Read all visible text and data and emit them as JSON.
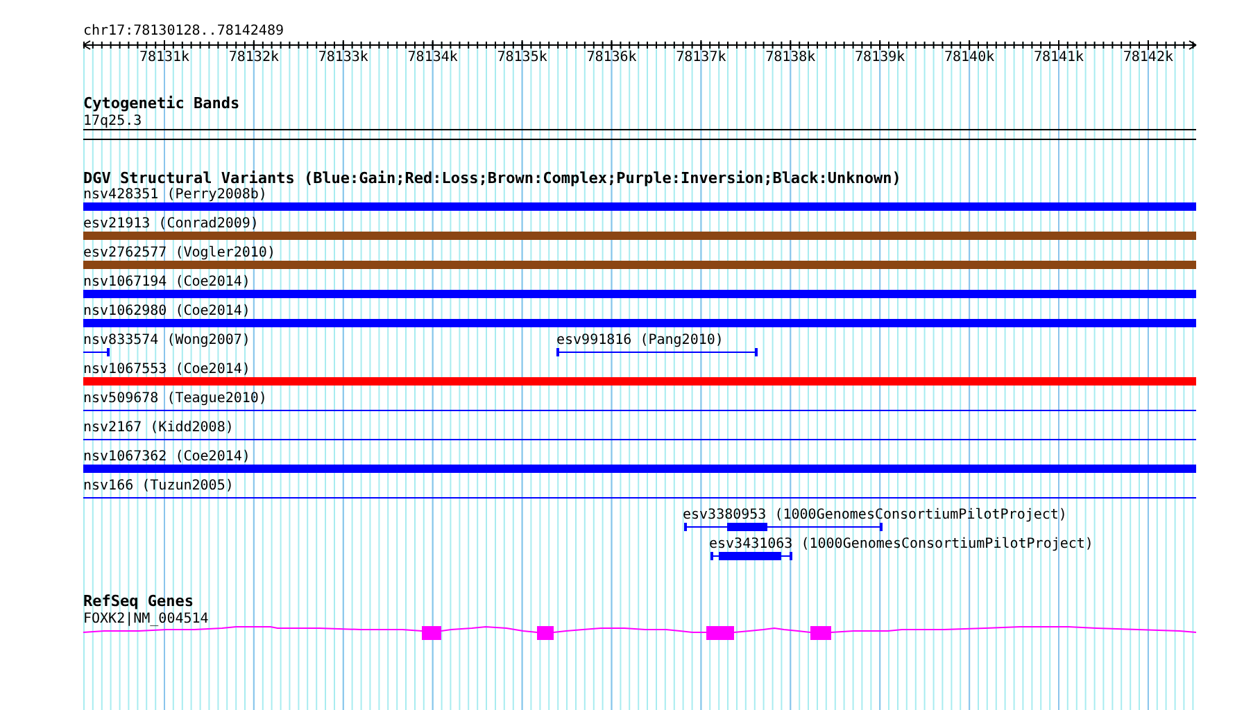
{
  "ruler": {
    "location": "chr17:78130128..78142489",
    "ticks": [
      "78131k",
      "78132k",
      "78133k",
      "78134k",
      "78135k",
      "78136k",
      "78137k",
      "78138k",
      "78139k",
      "78140k",
      "78141k",
      "78142k"
    ]
  },
  "cytogenetic_bands": {
    "title": "Cytogenetic Bands",
    "band": "17q25.3"
  },
  "dgv": {
    "title": "DGV Structural Variants (Blue:Gain;Red:Loss;Brown:Complex;Purple:Inversion;Black:Unknown)",
    "variants": [
      {
        "label": "nsv428351 (Perry2008b)",
        "color": "#0000ff",
        "kind": "bar"
      },
      {
        "label": "esv21913 (Conrad2009)",
        "color": "#8b4513",
        "kind": "bar"
      },
      {
        "label": "esv2762577 (Vogler2010)",
        "color": "#8b4513",
        "kind": "bar"
      },
      {
        "label": "nsv1067194 (Coe2014)",
        "color": "#0000ff",
        "kind": "bar"
      },
      {
        "label": "nsv1062980 (Coe2014)",
        "color": "#0000ff",
        "kind": "bar"
      },
      {
        "label": "nsv833574 (Wong2007)",
        "color": "#0000ff",
        "kind": "span"
      },
      {
        "label": "esv991816 (Pang2010)",
        "color": "#0000ff",
        "kind": "span"
      },
      {
        "label": "nsv1067553 (Coe2014)",
        "color": "#ff0000",
        "kind": "bar"
      },
      {
        "label": "nsv509678 (Teague2010)",
        "color": "#0000ff",
        "kind": "line"
      },
      {
        "label": "nsv2167 (Kidd2008)",
        "color": "#0000ff",
        "kind": "line"
      },
      {
        "label": "nsv1067362 (Coe2014)",
        "color": "#0000ff",
        "kind": "bar"
      },
      {
        "label": "nsv166 (Tuzun2005)",
        "color": "#0000ff",
        "kind": "line"
      },
      {
        "label": "esv3380953 (1000GenomesConsortiumPilotProject)",
        "color": "#0000ff",
        "kind": "span-block"
      },
      {
        "label": "esv3431063 (1000GenomesConsortiumPilotProject)",
        "color": "#0000ff",
        "kind": "span-block"
      }
    ]
  },
  "refseq": {
    "title": "RefSeq Genes",
    "gene": "FOXK2|NM_004514"
  }
}
